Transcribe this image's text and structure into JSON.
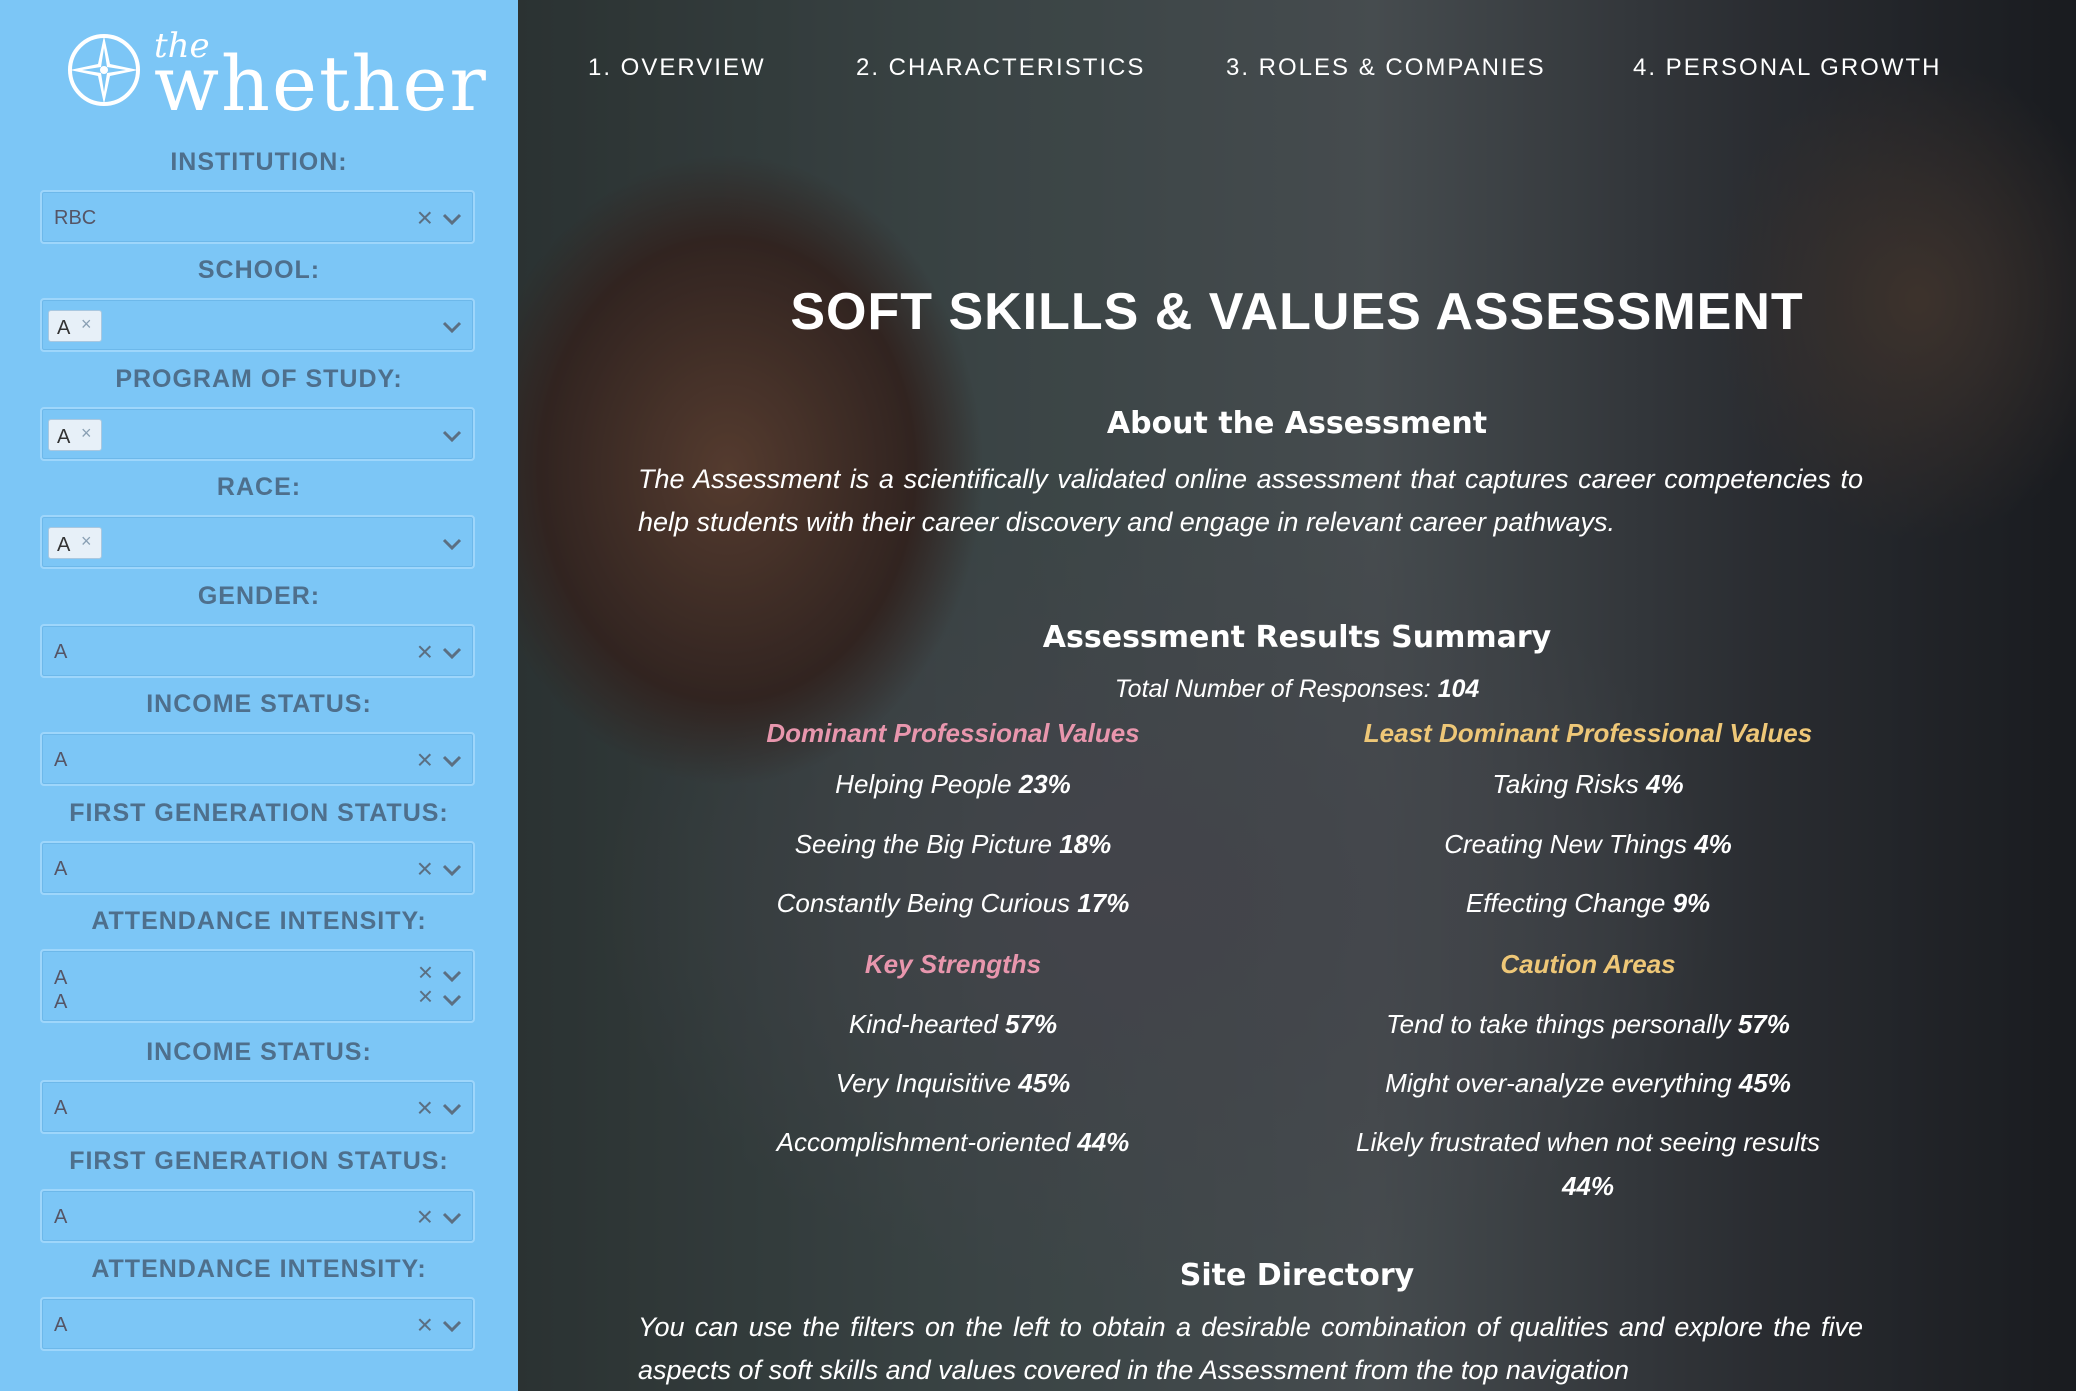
{
  "brand": {
    "small": "the",
    "word": "whether"
  },
  "filters": [
    {
      "label": "INSTITUTION:",
      "value": "RBC",
      "type": "single"
    },
    {
      "label": "SCHOOL:",
      "value": "A",
      "type": "chip"
    },
    {
      "label": "PROGRAM OF STUDY:",
      "value": "A",
      "type": "chip"
    },
    {
      "label": "RACE:",
      "value": "A",
      "type": "chip"
    },
    {
      "label": "GENDER:",
      "value": "A",
      "type": "single"
    },
    {
      "label": "INCOME STATUS:",
      "value": "A",
      "type": "single"
    },
    {
      "label": "FIRST GENERATION STATUS:",
      "value": "A",
      "type": "single"
    },
    {
      "label": "ATTENDANCE INTENSITY:",
      "value": "A",
      "value2": "A",
      "type": "double"
    },
    {
      "label": "INCOME STATUS:",
      "value": "A",
      "type": "single"
    },
    {
      "label": "FIRST GENERATION STATUS:",
      "value": "A",
      "type": "single"
    },
    {
      "label": "ATTENDANCE INTENSITY:",
      "value": "A",
      "type": "single"
    }
  ],
  "icons": {
    "clear": "×",
    "chip_remove": "×"
  },
  "nav": [
    "1. OVERVIEW",
    "2. CHARACTERISTICS",
    "3. ROLES & COMPANIES",
    "4. PERSONAL GROWTH"
  ],
  "main": {
    "title": "SOFT SKILLS & VALUES ASSESSMENT",
    "about_heading": "About the Assessment",
    "about_text": "The Assessment is a scientifically validated online assessment that captures career competencies to help students with their career discovery and engage in relevant career pathways.",
    "summary_heading": "Assessment Results Summary",
    "responses_label": "Total Number of Responses:",
    "responses_value": "104",
    "left_values_heading": "Dominant Professional Values",
    "right_values_heading": "Least Dominant Professional Values",
    "left_values": [
      {
        "text": "Helping People",
        "pct": "23%"
      },
      {
        "text": "Seeing the Big Picture",
        "pct": "18%"
      },
      {
        "text": "Constantly Being Curious",
        "pct": "17%"
      }
    ],
    "right_values": [
      {
        "text": "Taking Risks",
        "pct": "4%"
      },
      {
        "text": "Creating New Things",
        "pct": "4%"
      },
      {
        "text": "Effecting Change",
        "pct": "9%"
      }
    ],
    "left_strengths_heading": "Key Strengths",
    "right_strengths_heading": "Caution Areas",
    "left_strengths": [
      {
        "text": "Kind-hearted",
        "pct": "57%"
      },
      {
        "text": "Very Inquisitive",
        "pct": "45%"
      },
      {
        "text": "Accomplishment-oriented",
        "pct": "44%"
      }
    ],
    "right_strengths": [
      {
        "text": "Tend to take things personally",
        "pct": "57%"
      },
      {
        "text": "Might over-analyze everything",
        "pct": "45%"
      },
      {
        "text": "Likely frustrated when not seeing results",
        "pct": "44%"
      }
    ],
    "directory_heading": "Site Directory",
    "directory_text": "You can use the filters on the left to obtain a desirable combination of qualities and explore the five aspects of soft skills and values covered in the Assessment from the top navigation"
  }
}
